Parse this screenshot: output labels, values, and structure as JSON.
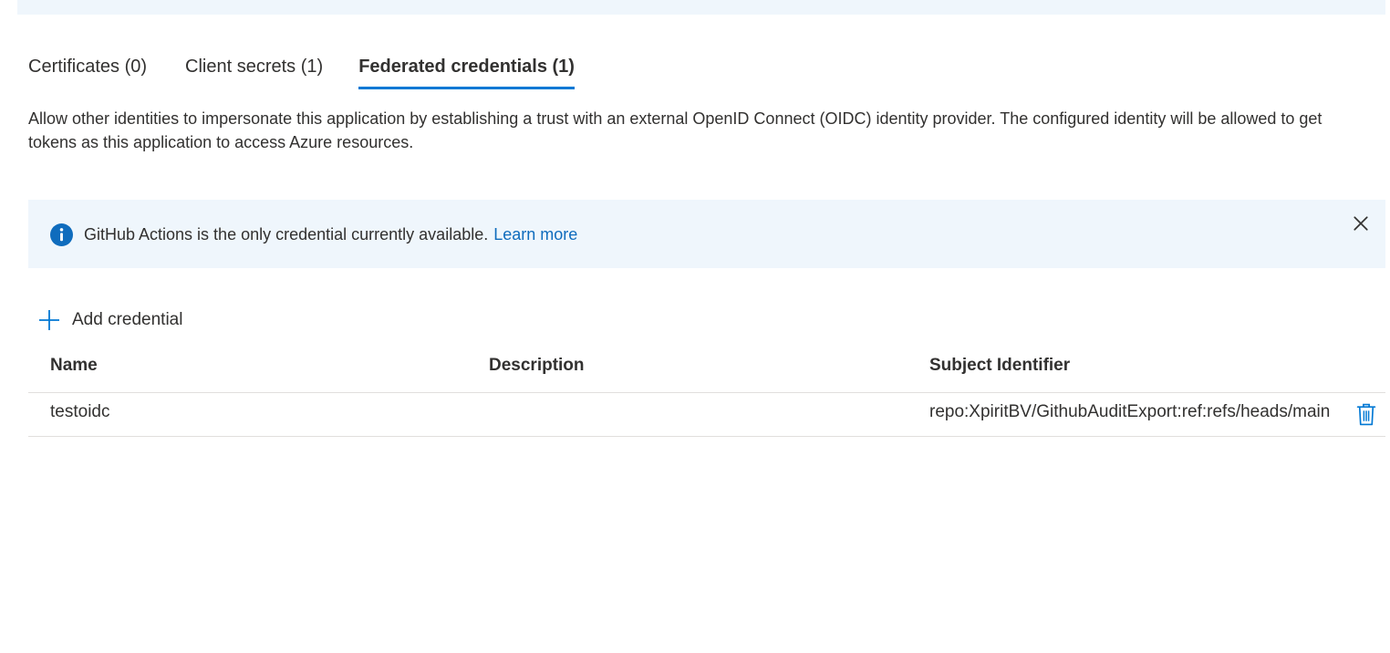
{
  "tabs": [
    {
      "label": "Certificates (0)",
      "active": false
    },
    {
      "label": "Client secrets (1)",
      "active": false
    },
    {
      "label": "Federated credentials (1)",
      "active": true
    }
  ],
  "description": "Allow other identities to impersonate this application by establishing a trust with an external OpenID Connect (OIDC) identity provider. The configured identity will be allowed to get tokens as this application to access Azure resources.",
  "info_bar": {
    "icon": "info-icon",
    "message": "GitHub Actions is the only credential currently available.",
    "link_text": "Learn more",
    "close_icon": "close-icon"
  },
  "add_button": {
    "icon": "plus-icon",
    "label": "Add credential"
  },
  "table": {
    "headers": {
      "name": "Name",
      "description": "Description",
      "subject": "Subject Identifier"
    },
    "rows": [
      {
        "name": "testoidc",
        "description": "",
        "subject": "repo:XpiritBV/GithubAuditExport:ref:refs/heads/main",
        "delete_icon": "trash-icon"
      }
    ]
  },
  "colors": {
    "accent": "#0078d4",
    "link": "#0f6cbd",
    "info_bg": "#eff6fc",
    "text": "#323130",
    "border": "#e1dfdd"
  }
}
